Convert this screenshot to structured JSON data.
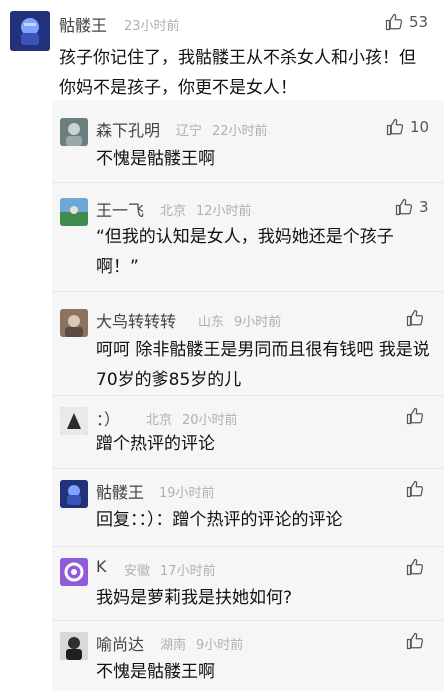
{
  "main": {
    "name": "骷髅王",
    "time": "23小时前",
    "likes": "53",
    "text": "孩子你记住了，我骷髅王从不杀女人和小孩！但你妈不是孩子，你更不是女人！",
    "colors": {
      "accent": "#6b8fd8"
    }
  },
  "replies": [
    {
      "name": "森下孔明",
      "location": "辽宁",
      "time": "22小时前",
      "likes": "10",
      "text": "不愧是骷髅王啊"
    },
    {
      "name": "王一飞",
      "location": "北京",
      "time": "12小时前",
      "likes": "3",
      "text": "“但我的认知是女人，我妈她还是个孩子啊！”"
    },
    {
      "name": "大鸟转转转",
      "location": "山东",
      "time": "9小时前",
      "likes": "",
      "text": "呵呵 除非骷髅王是男同而且很有钱吧 我是说70岁的爹85岁的儿"
    },
    {
      "name": "：）",
      "location": "北京",
      "time": "20小时前",
      "likes": "",
      "text": "蹭个热评的评论"
    },
    {
      "name": "骷髅王",
      "location": "",
      "time": "19小时前",
      "likes": "",
      "text": "回复：：）：蹭个热评的评论的评论"
    },
    {
      "name": "K",
      "location": "安徽",
      "time": "17小时前",
      "likes": "",
      "text": "我妈是萝莉我是扶她如何?"
    },
    {
      "name": "喻尚达",
      "location": "湖南",
      "time": "9小时前",
      "likes": "",
      "text": "不愧是骷髅王啊"
    }
  ],
  "icons": {
    "like": "thumbs-up-icon",
    "k_avatar": "circle-dot-icon"
  }
}
